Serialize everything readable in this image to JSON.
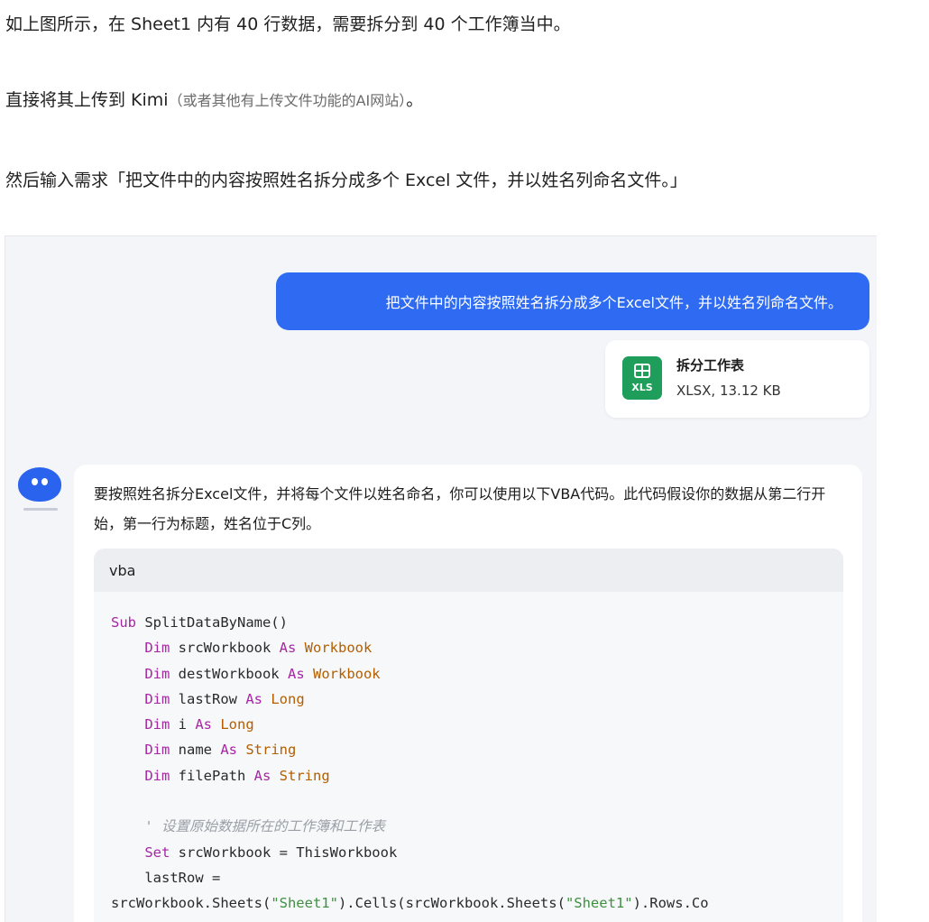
{
  "article": {
    "p1": "如上图所示，在 Sheet1 内有 40 行数据，需要拆分到 40 个工作簿当中。",
    "p2_main": "直接将其上传到 Kimi",
    "p2_note": "（或者其他有上传文件功能的AI网站）",
    "p2_end": "。",
    "p3": "然后输入需求「把文件中的内容按照姓名拆分成多个 Excel 文件，并以姓名列命名文件。」"
  },
  "chat": {
    "user_message": "把文件中的内容按照姓名拆分成多个Excel文件，并以姓名列命名文件。",
    "file": {
      "icon": "spreadsheet-icon",
      "badge": "XLS",
      "name": "拆分工作表",
      "meta": "XLSX, 13.12 KB"
    },
    "bot": {
      "avatar_icon": "kimi-bot-icon",
      "reply": "要按照姓名拆分Excel文件，并将每个文件以姓名命名，你可以使用以下VBA代码。此代码假设你的数据从第二行开始，第一行为标题，姓名位于C列。",
      "code_lang": "vba",
      "code_lines": [
        [
          {
            "t": "Sub",
            "c": "kw"
          },
          {
            "t": " SplitDataByName()"
          }
        ],
        [
          {
            "t": "    "
          },
          {
            "t": "Dim",
            "c": "kw"
          },
          {
            "t": " srcWorkbook "
          },
          {
            "t": "As",
            "c": "kw"
          },
          {
            "t": " Workbook",
            "c": "ty"
          }
        ],
        [
          {
            "t": "    "
          },
          {
            "t": "Dim",
            "c": "kw"
          },
          {
            "t": " destWorkbook "
          },
          {
            "t": "As",
            "c": "kw"
          },
          {
            "t": " Workbook",
            "c": "ty"
          }
        ],
        [
          {
            "t": "    "
          },
          {
            "t": "Dim",
            "c": "kw"
          },
          {
            "t": " lastRow "
          },
          {
            "t": "As",
            "c": "kw"
          },
          {
            "t": " Long",
            "c": "ty"
          }
        ],
        [
          {
            "t": "    "
          },
          {
            "t": "Dim",
            "c": "kw"
          },
          {
            "t": " i "
          },
          {
            "t": "As",
            "c": "kw"
          },
          {
            "t": " Long",
            "c": "ty"
          }
        ],
        [
          {
            "t": "    "
          },
          {
            "t": "Dim",
            "c": "kw"
          },
          {
            "t": " name "
          },
          {
            "t": "As",
            "c": "kw"
          },
          {
            "t": " String",
            "c": "ty"
          }
        ],
        [
          {
            "t": "    "
          },
          {
            "t": "Dim",
            "c": "kw"
          },
          {
            "t": " filePath "
          },
          {
            "t": "As",
            "c": "kw"
          },
          {
            "t": " String",
            "c": "ty"
          }
        ],
        [
          {
            "t": ""
          }
        ],
        [
          {
            "t": "    "
          },
          {
            "t": "' 设置原始数据所在的工作簿和工作表",
            "c": "cm"
          }
        ],
        [
          {
            "t": "    "
          },
          {
            "t": "Set",
            "c": "kw"
          },
          {
            "t": " srcWorkbook = ThisWorkbook"
          }
        ],
        [
          {
            "t": "    lastRow ="
          }
        ],
        [
          {
            "t": "srcWorkbook.Sheets("
          },
          {
            "t": "\"Sheet1\"",
            "c": "st"
          },
          {
            "t": ").Cells(srcWorkbook.Sheets("
          },
          {
            "t": "\"Sheet1\"",
            "c": "st"
          },
          {
            "t": ").Rows.Co"
          }
        ]
      ]
    }
  },
  "colors": {
    "user_bubble": "#2f6bf2",
    "xls_green": "#1e9e5a",
    "keyword": "#a626a4",
    "type": "#b35e00",
    "string": "#3f8f3f",
    "comment": "#9aa0a6"
  }
}
